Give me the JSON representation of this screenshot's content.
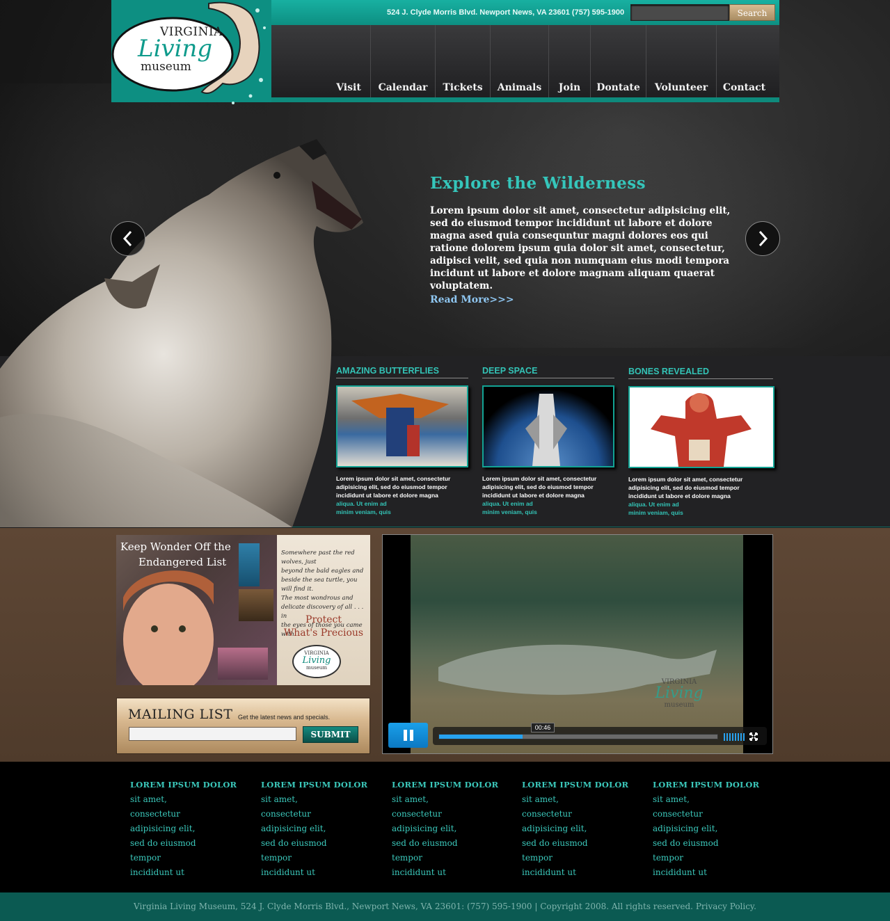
{
  "header": {
    "address": "524 J. Clyde Morris Blvd. Newport News, VA 23601  (757) 595-1900",
    "search_placeholder": "",
    "search_label": "Search",
    "logo": {
      "line1": "VIRGINIA",
      "line2": "Living",
      "line3": "museum"
    }
  },
  "nav": [
    "Visit",
    "Calendar",
    "Tickets",
    "Animals",
    "Join",
    "Dontate",
    "Volunteer",
    "Contact"
  ],
  "hero": {
    "title": "Explore the Wilderness",
    "body": "Lorem ipsum dolor sit amet, consectetur adipisicing elit, sed do eiusmod tempor incididunt ut labore et dolore magna ased quia consequntur magni dolores eos qui ratione dolorem ipsum quia dolor sit amet, consectetur, adipisci velit, sed quia non numquam eius modi tempora incidunt ut labore et dolore magnam aliquam quaerat voluptatem.",
    "read_more": "Read More>>>"
  },
  "features": [
    {
      "title": "AMAZING BUTTERFLIES",
      "text": "Lorem ipsum dolor sit amet, consectetur adipisicing elit, sed do eiusmod tempor incididunt ut labore et dolore magna",
      "teal1": "aliqua. Ut enim ad",
      "teal2": "minim veniam, quis"
    },
    {
      "title": "DEEP SPACE",
      "text": "Lorem ipsum dolor sit amet, consectetur adipisicing elit, sed do eiusmod tempor incididunt ut labore et dolore magna",
      "teal1": "aliqua. Ut enim ad",
      "teal2": "minim veniam, quis"
    },
    {
      "title": "BONES REVEALED",
      "text": "Lorem ipsum dolor sit amet, consectetur adipisicing elit, sed do eiusmod tempor incididunt ut labore et dolore magna",
      "teal1": "aliqua. Ut enim ad",
      "teal2": "minim veniam, quis"
    }
  ],
  "promo": {
    "headline1": "Keep Wonder Off the",
    "headline2": "Endangered List",
    "quote": [
      "Somewhere past the red wolves, just",
      "beyond the bald eagles and",
      "beside the sea turtle, you will find it.",
      "The most wondrous and",
      "delicate discovery of all . . . in",
      "the eyes of those you came with."
    ],
    "cta1": "Protect",
    "cta2": "What's Precious",
    "logo1": "VIRGINIA",
    "logo2": "Living",
    "logo3": "museum"
  },
  "mailing": {
    "title": "MAILING LIST",
    "subtitle": "Get the latest news and specials.",
    "input_placeholder": "",
    "submit": "SUBMIT"
  },
  "video": {
    "time": "00:46",
    "progress": 0.3,
    "watermark1": "VIRGINIA",
    "watermark2": "Living",
    "watermark3": "museum"
  },
  "footer_columns": [
    {
      "heading": "LOREM IPSUM DOLOR",
      "links": [
        "sit amet,",
        "consectetur",
        "adipisicing elit,",
        "sed do eiusmod",
        "tempor",
        "incididunt ut"
      ]
    },
    {
      "heading": "LOREM IPSUM DOLOR",
      "links": [
        "sit amet,",
        "consectetur",
        "adipisicing elit,",
        "sed do eiusmod",
        "tempor",
        "incididunt ut"
      ]
    },
    {
      "heading": "LOREM IPSUM DOLOR",
      "links": [
        "sit amet,",
        "consectetur",
        "adipisicing elit,",
        "sed do eiusmod",
        "tempor",
        "incididunt ut"
      ]
    },
    {
      "heading": "LOREM IPSUM DOLOR",
      "links": [
        "sit amet,",
        "consectetur",
        "adipisicing elit,",
        "sed do eiusmod",
        "tempor",
        "incididunt ut"
      ]
    },
    {
      "heading": "LOREM IPSUM DOLOR",
      "links": [
        "sit amet,",
        "consectetur",
        "adipisicing elit,",
        "sed do eiusmod",
        "tempor",
        "incididunt ut"
      ]
    }
  ],
  "bottom": {
    "text": "Virginia Living Museum, 524 J. Clyde Morris Blvd., Newport News, VA 23601:   (757) 595-1900     |     Copyright 2008.   All rights reserved.",
    "privacy": "Privacy Policy."
  },
  "colors": {
    "teal": "#0e8a7c",
    "teal_text": "#35c6bb",
    "link_blue": "#8fc7f2",
    "brown": "#5e4735",
    "footer_bar": "#0b5a52"
  }
}
